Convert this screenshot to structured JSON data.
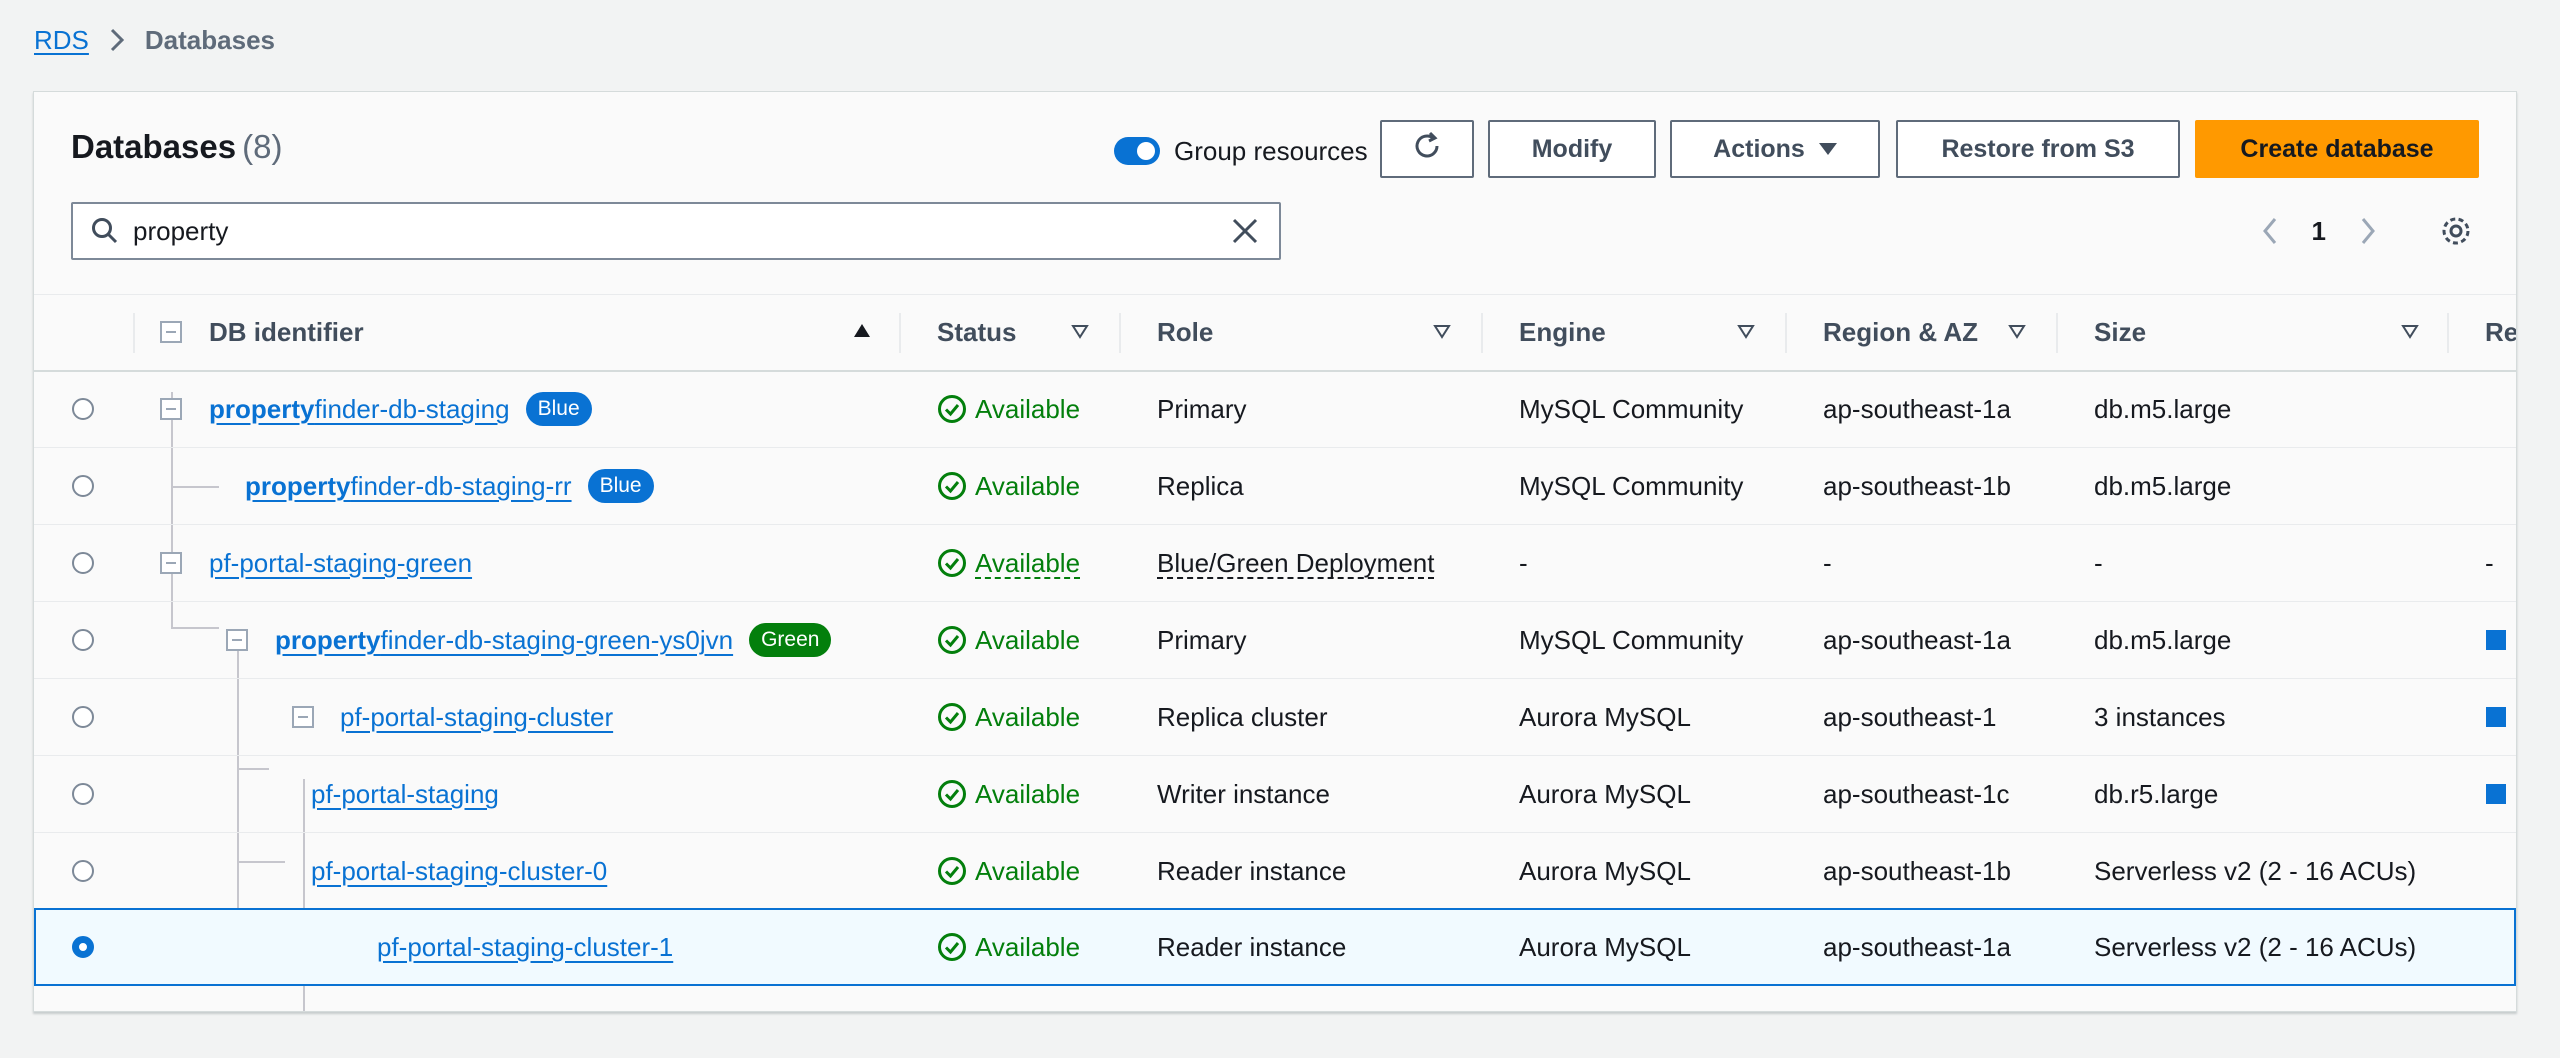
{
  "breadcrumb": {
    "root": "RDS",
    "current": "Databases"
  },
  "header": {
    "title": "Databases",
    "count": "(8)"
  },
  "toolbar": {
    "group_resources_label": "Group resources",
    "modify_label": "Modify",
    "actions_label": "Actions",
    "restore_label": "Restore from S3",
    "create_label": "Create database"
  },
  "search": {
    "value": "property"
  },
  "pagination": {
    "page": "1"
  },
  "columns": {
    "identifier": "DB identifier",
    "status": "Status",
    "role": "Role",
    "engine": "Engine",
    "region": "Region & AZ",
    "size": "Size",
    "recommendations": "Re"
  },
  "rows": [
    {
      "id_bold": "property",
      "id_rest": "finder-db-staging",
      "badge": "Blue",
      "status": "Available",
      "role": "Primary",
      "engine": "MySQL Community",
      "region": "ap-southeast-1a",
      "size": "db.m5.large",
      "extra": ""
    },
    {
      "id_bold": "property",
      "id_rest": "finder-db-staging-rr",
      "badge": "Blue",
      "status": "Available",
      "role": "Replica",
      "engine": "MySQL Community",
      "region": "ap-southeast-1b",
      "size": "db.m5.large",
      "extra": ""
    },
    {
      "id_bold": "",
      "id_rest": "pf-portal-staging-green",
      "badge": "",
      "status": "Available",
      "role": "Blue/Green Deployment",
      "engine": "-",
      "region": "-",
      "size": "-",
      "extra": "-"
    },
    {
      "id_bold": "property",
      "id_rest": "finder-db-staging-green-ys0jvn",
      "badge": "Green",
      "status": "Available",
      "role": "Primary",
      "engine": "MySQL Community",
      "region": "ap-southeast-1a",
      "size": "db.m5.large",
      "extra": ""
    },
    {
      "id_bold": "",
      "id_rest": "pf-portal-staging-cluster",
      "badge": "",
      "status": "Available",
      "role": "Replica cluster",
      "engine": "Aurora MySQL",
      "region": "ap-southeast-1",
      "size": "3 instances",
      "extra": ""
    },
    {
      "id_bold": "",
      "id_rest": "pf-portal-staging",
      "badge": "",
      "status": "Available",
      "role": "Writer instance",
      "engine": "Aurora MySQL",
      "region": "ap-southeast-1c",
      "size": "db.r5.large",
      "extra": ""
    },
    {
      "id_bold": "",
      "id_rest": "pf-portal-staging-cluster-0",
      "badge": "",
      "status": "Available",
      "role": "Reader instance",
      "engine": "Aurora MySQL",
      "region": "ap-southeast-1b",
      "size": "Serverless v2 (2 - 16 ACUs)",
      "extra": ""
    },
    {
      "id_bold": "",
      "id_rest": "pf-portal-staging-cluster-1",
      "badge": "",
      "status": "Available",
      "role": "Reader instance",
      "engine": "Aurora MySQL",
      "region": "ap-southeast-1a",
      "size": "Serverless v2 (2 - 16 ACUs)",
      "extra": ""
    }
  ],
  "colors": {
    "link": "#0972d3",
    "success": "#037f0c",
    "primary_button": "#ff9900"
  }
}
